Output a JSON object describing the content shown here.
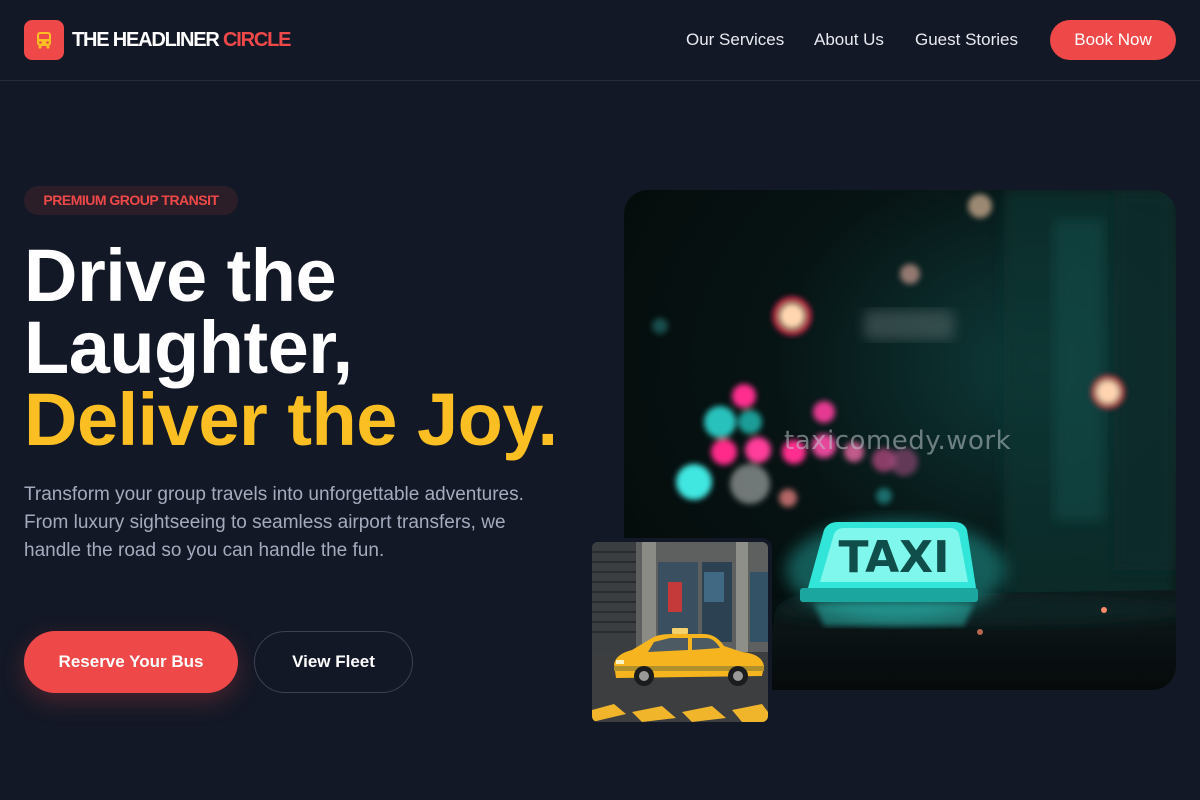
{
  "header": {
    "logo_primary": "THE HEADLINER",
    "logo_accent": "CIRCLE",
    "logo_icon": "bus-icon",
    "nav": [
      "Our Services",
      "About Us",
      "Guest Stories"
    ],
    "book_label": "Book Now"
  },
  "hero": {
    "badge": "PREMIUM GROUP TRANSIT",
    "headline_line1": "Drive the",
    "headline_line2": "Laughter,",
    "headline_line3": "Deliver the Joy.",
    "description": "Transform your group travels into unforgettable adventures. From luxury sightseeing to seamless airport transfers, we handle the road so you can handle the fun.",
    "primary_button": "Reserve Your Bus",
    "secondary_button": "View Fleet"
  },
  "images": {
    "main_sign_text": "TAXI",
    "watermark": "taxicomedy.work"
  },
  "colors": {
    "background": "#131826",
    "accent": "#ef4848",
    "highlight": "#fbbf24",
    "neon": "#40e0d0"
  }
}
